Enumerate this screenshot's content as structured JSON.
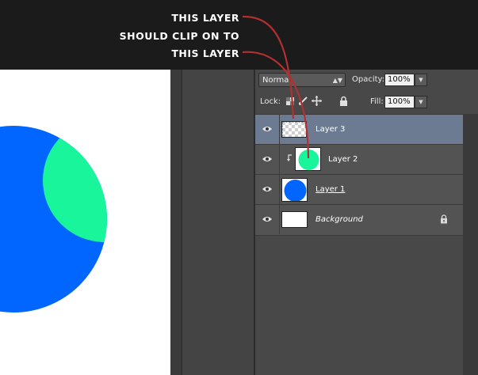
{
  "annotations": [
    "THIS LAYER",
    "SHOULD CLIP ON TO",
    "THIS LAYER"
  ],
  "layers_panel": {
    "blend_mode": "Normal",
    "opacity_label": "Opacity:",
    "opacity_value": "100%",
    "lock_label": "Lock:",
    "fill_label": "Fill:",
    "fill_value": "100%"
  },
  "layers": [
    {
      "name": "Layer 3",
      "selected": true,
      "clipped": false,
      "thumb": "transparent"
    },
    {
      "name": "Layer 2",
      "selected": false,
      "clipped": true,
      "thumb": "#19f59b"
    },
    {
      "name": "Layer 1",
      "selected": false,
      "clipped": false,
      "thumb": "#0066ff"
    },
    {
      "name": "Background",
      "selected": false,
      "clipped": false,
      "thumb": "#ffffff",
      "locked": true
    }
  ],
  "colors": {
    "blue_circle": "#0066ff",
    "green_circle": "#19f59b",
    "arrow": "#b23030",
    "selected_row": "#6c7b91"
  },
  "icons": [
    "eye-icon",
    "checkerboard-icon",
    "brush-icon",
    "move-icon",
    "lock-icon",
    "clip-arrow-icon"
  ]
}
